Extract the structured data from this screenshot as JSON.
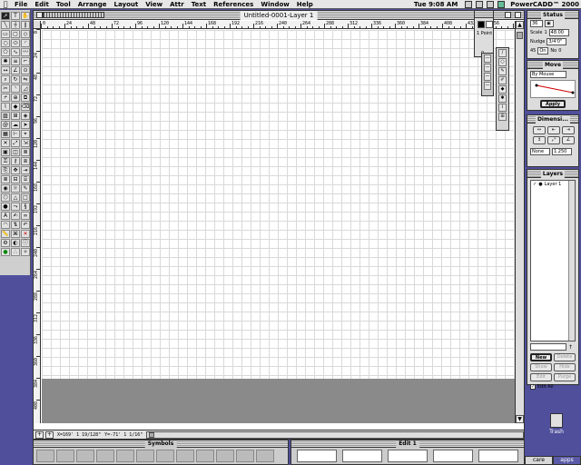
{
  "menubar": {
    "items": [
      "File",
      "Edit",
      "Tool",
      "Arrange",
      "Layout",
      "View",
      "Attr",
      "Text",
      "References",
      "Window",
      "Help"
    ],
    "clock": "Tue 9:08 AM",
    "app_name": "PowerCADD™ 2000"
  },
  "document": {
    "title": "Untitled-0001-Layer 1",
    "ruler_top_labels": [
      "0",
      "24",
      "48",
      "72",
      "96",
      "120",
      "144",
      "168",
      "192",
      "216",
      "240",
      "264",
      "288",
      "312",
      "336",
      "360",
      "384",
      "408",
      "432",
      "456",
      "480"
    ],
    "ruler_left_labels": [
      "0",
      "24",
      "48",
      "72",
      "96",
      "120",
      "144",
      "168",
      "192",
      "216",
      "240",
      "264",
      "288",
      "312",
      "336",
      "360",
      "384",
      "408"
    ],
    "status_x": "X=169' 1 19/128\"",
    "status_y": "Y=-71' 1 1/16\""
  },
  "pen_palette": {
    "pen_size": "1 Point",
    "number": "0"
  },
  "status_panel": {
    "title": "Status",
    "scale_label": "Scale",
    "scale_value": "1",
    "scale_field": "48.00",
    "nudge_label": "Nudge",
    "nudge_value": "3/4'0\"",
    "value_36": "36",
    "angle_label": "45",
    "on_label": "On",
    "no_label": "No",
    "zero": "0"
  },
  "move_panel": {
    "title": "Move",
    "mode": "By Mouse",
    "apply_label": "Apply"
  },
  "dimension_panel": {
    "title": "Dimensi...",
    "none_label": "None",
    "val_label": "1.250"
  },
  "layers_panel": {
    "title": "Layers",
    "layers": [
      {
        "name": "Layer 1",
        "checked": "✓"
      }
    ],
    "new_label": "New",
    "delete_label": "Delete",
    "show_label": "Show",
    "hide_label": "Hide",
    "edit_label": "Edit",
    "purge_label": "Purge",
    "edit_all_label": "Edit All"
  },
  "trash": {
    "label": "Trash"
  },
  "symbols_palette": {
    "title": "Symbols"
  },
  "edit_palette": {
    "title": "Edit 1"
  },
  "dock": {
    "tabs": [
      "care",
      "apps"
    ]
  },
  "colors": {
    "desktop": "#4f4f9c",
    "pasteboard": "#8a8a8a"
  }
}
